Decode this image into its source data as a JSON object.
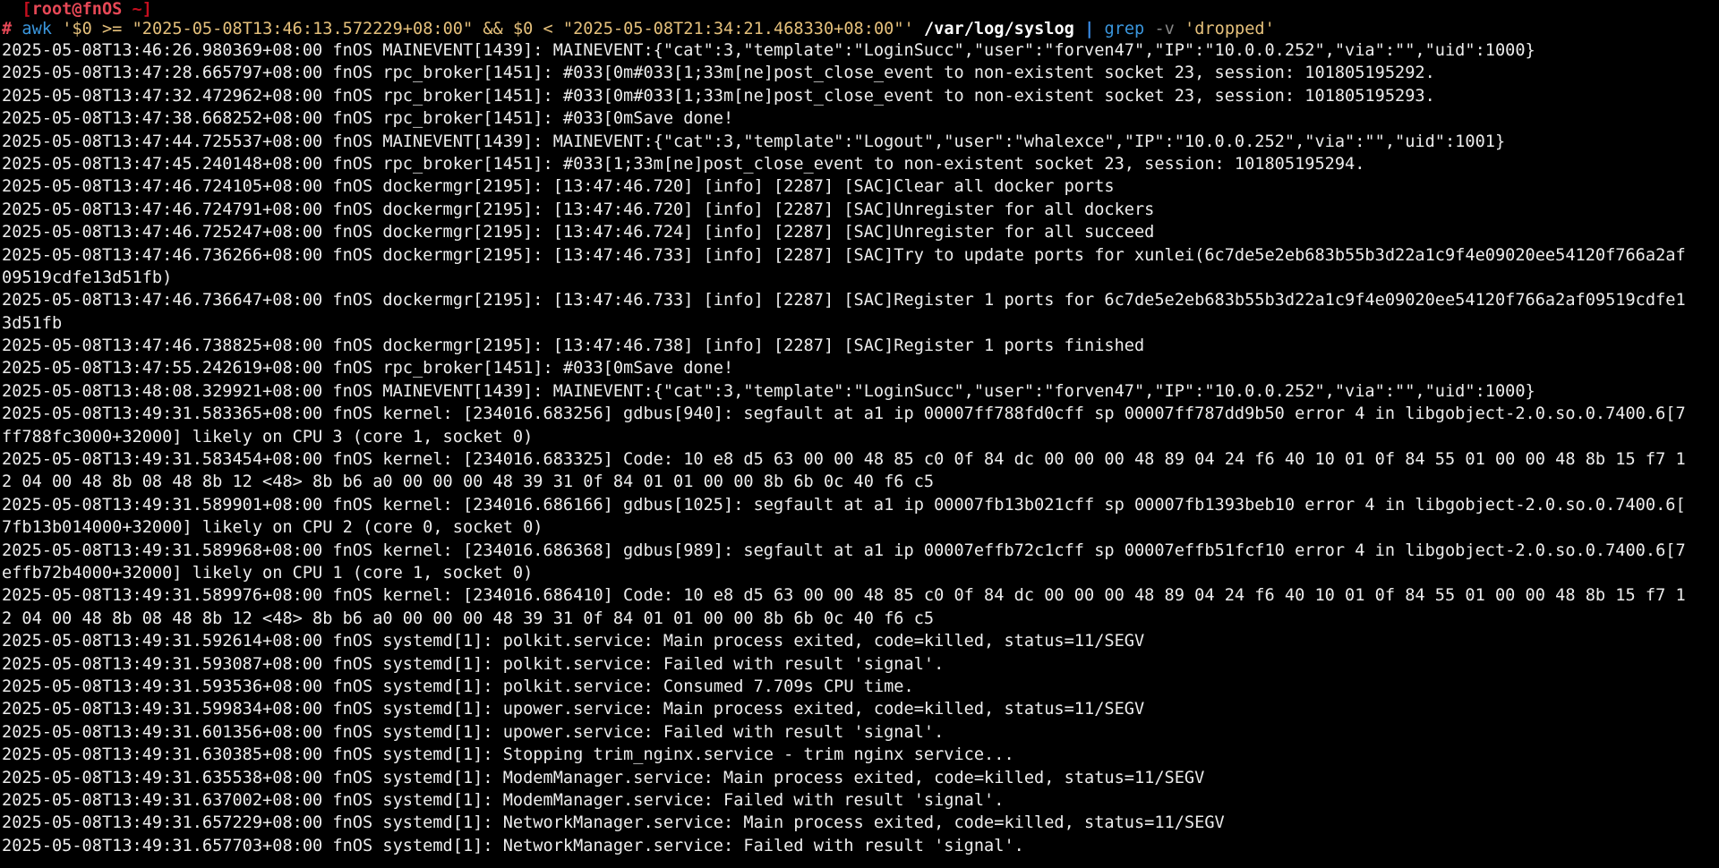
{
  "terminal": {
    "prompt": {
      "open_bracket": "[",
      "user_host": "root@fnOS",
      "cwd": " ~",
      "close_bracket": "]"
    },
    "command": {
      "hash": "#",
      "awk": "awk",
      "awk_script": "'$0 >= \"2025-05-08T13:46:13.572229+08:00\" && $0 < \"2025-05-08T21:34:21.468330+08:00\"'",
      "file": "/var/log/syslog",
      "pipe": "|",
      "grep": "grep",
      "grep_flag": "-v",
      "grep_pattern": "'dropped'"
    },
    "output_lines": [
      "2025-05-08T13:46:26.980369+08:00 fnOS MAINEVENT[1439]: MAINEVENT:{\"cat\":3,\"template\":\"LoginSucc\",\"user\":\"forven47\",\"IP\":\"10.0.0.252\",\"via\":\"\",\"uid\":1000}",
      "2025-05-08T13:47:28.665797+08:00 fnOS rpc_broker[1451]: #033[0m#033[1;33m[ne]post_close_event to non-existent socket 23, session: 101805195292.",
      "2025-05-08T13:47:32.472962+08:00 fnOS rpc_broker[1451]: #033[0m#033[1;33m[ne]post_close_event to non-existent socket 23, session: 101805195293.",
      "2025-05-08T13:47:38.668252+08:00 fnOS rpc_broker[1451]: #033[0mSave done!",
      "2025-05-08T13:47:44.725537+08:00 fnOS MAINEVENT[1439]: MAINEVENT:{\"cat\":3,\"template\":\"Logout\",\"user\":\"whalexce\",\"IP\":\"10.0.0.252\",\"via\":\"\",\"uid\":1001}",
      "2025-05-08T13:47:45.240148+08:00 fnOS rpc_broker[1451]: #033[1;33m[ne]post_close_event to non-existent socket 23, session: 101805195294.",
      "2025-05-08T13:47:46.724105+08:00 fnOS dockermgr[2195]: [13:47:46.720] [info] [2287] [SAC]Clear all docker ports",
      "2025-05-08T13:47:46.724791+08:00 fnOS dockermgr[2195]: [13:47:46.720] [info] [2287] [SAC]Unregister for all dockers",
      "2025-05-08T13:47:46.725247+08:00 fnOS dockermgr[2195]: [13:47:46.724] [info] [2287] [SAC]Unregister for all succeed",
      "2025-05-08T13:47:46.736266+08:00 fnOS dockermgr[2195]: [13:47:46.733] [info] [2287] [SAC]Try to update ports for xunlei(6c7de5e2eb683b55b3d22a1c9f4e09020ee54120f766a2af",
      "09519cdfe13d51fb)",
      "2025-05-08T13:47:46.736647+08:00 fnOS dockermgr[2195]: [13:47:46.733] [info] [2287] [SAC]Register 1 ports for 6c7de5e2eb683b55b3d22a1c9f4e09020ee54120f766a2af09519cdfe1",
      "3d51fb",
      "2025-05-08T13:47:46.738825+08:00 fnOS dockermgr[2195]: [13:47:46.738] [info] [2287] [SAC]Register 1 ports finished",
      "2025-05-08T13:47:55.242619+08:00 fnOS rpc_broker[1451]: #033[0mSave done!",
      "2025-05-08T13:48:08.329921+08:00 fnOS MAINEVENT[1439]: MAINEVENT:{\"cat\":3,\"template\":\"LoginSucc\",\"user\":\"forven47\",\"IP\":\"10.0.0.252\",\"via\":\"\",\"uid\":1000}",
      "2025-05-08T13:49:31.583365+08:00 fnOS kernel: [234016.683256] gdbus[940]: segfault at a1 ip 00007ff788fd0cff sp 00007ff787dd9b50 error 4 in libgobject-2.0.so.0.7400.6[7",
      "ff788fc3000+32000] likely on CPU 3 (core 1, socket 0)",
      "2025-05-08T13:49:31.583454+08:00 fnOS kernel: [234016.683325] Code: 10 e8 d5 63 00 00 48 85 c0 0f 84 dc 00 00 00 48 89 04 24 f6 40 10 01 0f 84 55 01 00 00 48 8b 15 f7 1",
      "2 04 00 48 8b 08 48 8b 12 <48> 8b b6 a0 00 00 00 48 39 31 0f 84 01 01 00 00 8b 6b 0c 40 f6 c5",
      "2025-05-08T13:49:31.589901+08:00 fnOS kernel: [234016.686166] gdbus[1025]: segfault at a1 ip 00007fb13b021cff sp 00007fb1393beb10 error 4 in libgobject-2.0.so.0.7400.6[",
      "7fb13b014000+32000] likely on CPU 2 (core 0, socket 0)",
      "2025-05-08T13:49:31.589968+08:00 fnOS kernel: [234016.686368] gdbus[989]: segfault at a1 ip 00007effb72c1cff sp 00007effb51fcf10 error 4 in libgobject-2.0.so.0.7400.6[7",
      "effb72b4000+32000] likely on CPU 1 (core 1, socket 0)",
      "2025-05-08T13:49:31.589976+08:00 fnOS kernel: [234016.686410] Code: 10 e8 d5 63 00 00 48 85 c0 0f 84 dc 00 00 00 48 89 04 24 f6 40 10 01 0f 84 55 01 00 00 48 8b 15 f7 1",
      "2 04 00 48 8b 08 48 8b 12 <48> 8b b6 a0 00 00 00 48 39 31 0f 84 01 01 00 00 8b 6b 0c 40 f6 c5",
      "2025-05-08T13:49:31.592614+08:00 fnOS systemd[1]: polkit.service: Main process exited, code=killed, status=11/SEGV",
      "2025-05-08T13:49:31.593087+08:00 fnOS systemd[1]: polkit.service: Failed with result 'signal'.",
      "2025-05-08T13:49:31.593536+08:00 fnOS systemd[1]: polkit.service: Consumed 7.709s CPU time.",
      "2025-05-08T13:49:31.599834+08:00 fnOS systemd[1]: upower.service: Main process exited, code=killed, status=11/SEGV",
      "2025-05-08T13:49:31.601356+08:00 fnOS systemd[1]: upower.service: Failed with result 'signal'.",
      "2025-05-08T13:49:31.630385+08:00 fnOS systemd[1]: Stopping trim_nginx.service - trim nginx service...",
      "2025-05-08T13:49:31.635538+08:00 fnOS systemd[1]: ModemManager.service: Main process exited, code=killed, status=11/SEGV",
      "2025-05-08T13:49:31.637002+08:00 fnOS systemd[1]: ModemManager.service: Failed with result 'signal'.",
      "2025-05-08T13:49:31.657229+08:00 fnOS systemd[1]: NetworkManager.service: Main process exited, code=killed, status=11/SEGV",
      "2025-05-08T13:49:31.657703+08:00 fnOS systemd[1]: NetworkManager.service: Failed with result 'signal'."
    ]
  }
}
